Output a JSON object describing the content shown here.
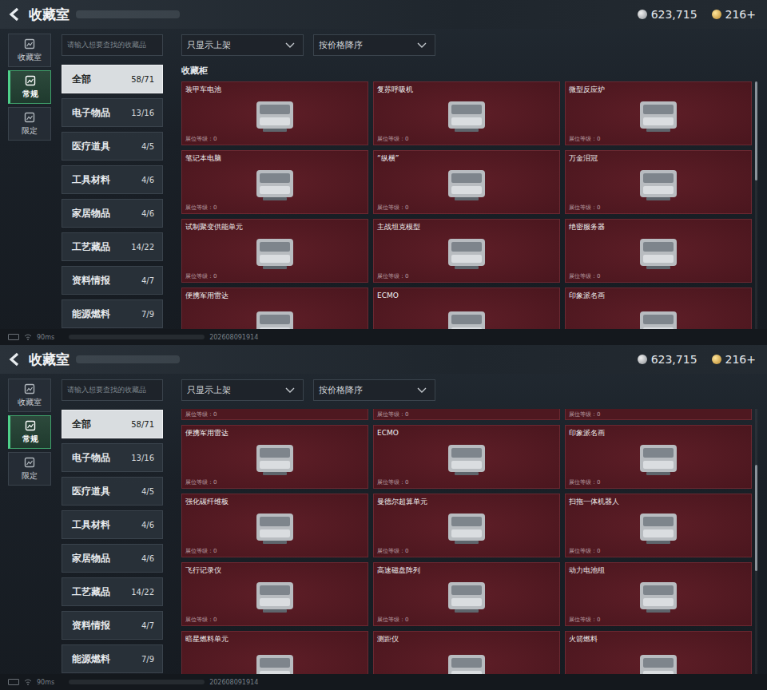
{
  "screens": [
    {
      "header": {
        "title": "收藏室",
        "currency": [
          {
            "amount": "623,715",
            "kind": "silver"
          },
          {
            "amount": "216+",
            "kind": "gold"
          }
        ]
      },
      "rail": [
        {
          "label": "收藏室",
          "selected": false
        },
        {
          "label": "常规",
          "selected": true
        },
        {
          "label": "限定",
          "selected": false
        }
      ],
      "search": {
        "placeholder": "请输入想要查找的收藏品"
      },
      "categories": [
        {
          "label": "全部",
          "count": "58/71",
          "selected": true
        },
        {
          "label": "电子物品",
          "count": "13/16",
          "selected": false
        },
        {
          "label": "医疗道具",
          "count": "4/5",
          "selected": false
        },
        {
          "label": "工具材料",
          "count": "4/6",
          "selected": false
        },
        {
          "label": "家居物品",
          "count": "4/6",
          "selected": false
        },
        {
          "label": "工艺藏品",
          "count": "14/22",
          "selected": false
        },
        {
          "label": "资料情报",
          "count": "4/7",
          "selected": false
        },
        {
          "label": "能源燃料",
          "count": "7/9",
          "selected": false
        }
      ],
      "filters": [
        "只显示上架",
        "按价格降序"
      ],
      "section_title": "收藏柜",
      "cut_row": [],
      "items": [
        {
          "name": "装甲车电池",
          "level_label": "展位等级：0"
        },
        {
          "name": "复苏呼吸机",
          "level_label": "展位等级：0"
        },
        {
          "name": "微型反应炉",
          "level_label": "展位等级：0"
        },
        {
          "name": "笔记本电脑",
          "level_label": "展位等级：0"
        },
        {
          "name": "“纵横”",
          "level_label": "展位等级：0"
        },
        {
          "name": "万金泪冠",
          "level_label": "展位等级：0"
        },
        {
          "name": "试制聚变供能单元",
          "level_label": "展位等级：0"
        },
        {
          "name": "主战坦克模型",
          "level_label": "展位等级：0"
        },
        {
          "name": "绝密服务器",
          "level_label": "展位等级：0"
        },
        {
          "name": "便携军用雷达",
          "level_label": ""
        },
        {
          "name": "ECMO",
          "level_label": ""
        },
        {
          "name": "印象派名画",
          "level_label": ""
        }
      ],
      "scroll_level": 0,
      "status": {
        "ping": "90ms",
        "stamp": "202608091914"
      }
    },
    {
      "header": {
        "title": "收藏室",
        "currency": [
          {
            "amount": "623,715",
            "kind": "silver"
          },
          {
            "amount": "216+",
            "kind": "gold"
          }
        ]
      },
      "rail": [
        {
          "label": "收藏室",
          "selected": false
        },
        {
          "label": "常规",
          "selected": true
        },
        {
          "label": "限定",
          "selected": false
        }
      ],
      "search": {
        "placeholder": "请输入想要查找的收藏品"
      },
      "categories": [
        {
          "label": "全部",
          "count": "58/71",
          "selected": true
        },
        {
          "label": "电子物品",
          "count": "13/16",
          "selected": false
        },
        {
          "label": "医疗道具",
          "count": "4/5",
          "selected": false
        },
        {
          "label": "工具材料",
          "count": "4/6",
          "selected": false
        },
        {
          "label": "家居物品",
          "count": "4/6",
          "selected": false
        },
        {
          "label": "工艺藏品",
          "count": "14/22",
          "selected": false
        },
        {
          "label": "资料情报",
          "count": "4/7",
          "selected": false
        },
        {
          "label": "能源燃料",
          "count": "7/9",
          "selected": false
        }
      ],
      "filters": [
        "只显示上架",
        "按价格降序"
      ],
      "section_title": "",
      "cut_row": [
        "展位等级：0",
        "展位等级：0",
        "展位等级：0"
      ],
      "items": [
        {
          "name": "便携军用雷达",
          "level_label": "展位等级：0"
        },
        {
          "name": "ECMO",
          "level_label": "展位等级：0"
        },
        {
          "name": "印象派名画",
          "level_label": "展位等级：0"
        },
        {
          "name": "强化碳纤维板",
          "level_label": "展位等级：0"
        },
        {
          "name": "曼德尔超算单元",
          "level_label": "展位等级：0"
        },
        {
          "name": "扫拖一体机器人",
          "level_label": "展位等级：0"
        },
        {
          "name": "飞行记录仪",
          "level_label": "展位等级：0"
        },
        {
          "name": "高速磁盘阵列",
          "level_label": "展位等级：0"
        },
        {
          "name": "动力电池组",
          "level_label": "展位等级：0"
        },
        {
          "name": "暗星燃料单元",
          "level_label": ""
        },
        {
          "name": "测距仪",
          "level_label": ""
        },
        {
          "name": "火箭燃料",
          "level_label": ""
        }
      ],
      "scroll_level": 0.35,
      "status": {
        "ping": "90ms",
        "stamp": "202608091914"
      }
    }
  ]
}
